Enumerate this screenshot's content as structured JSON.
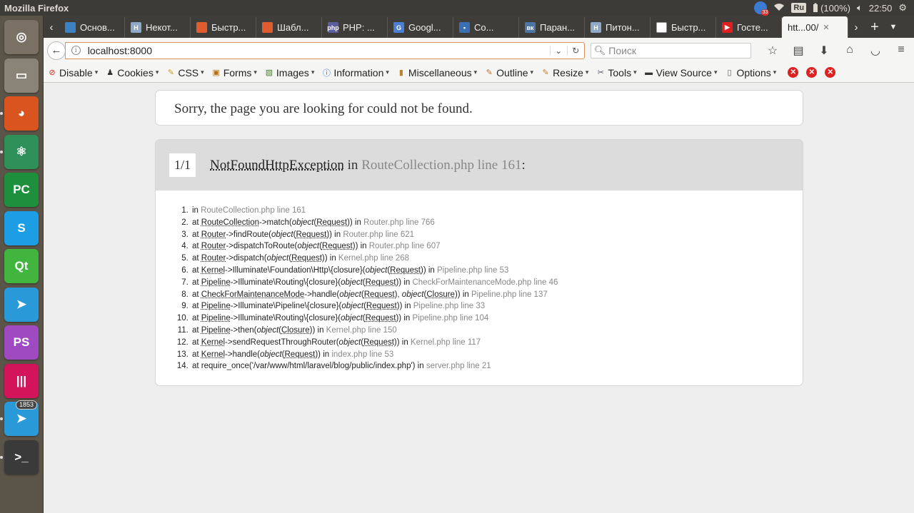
{
  "window": {
    "title": "Mozilla Firefox"
  },
  "tray": {
    "badge_count": "33",
    "keyboard": "Ru",
    "battery": "(100%)",
    "clock": "22:50"
  },
  "launcher": [
    {
      "name": "dash-home-icon",
      "color": "#7a7164"
    },
    {
      "name": "files-icon",
      "color": "#8a8378"
    },
    {
      "name": "firefox-icon",
      "color": "#d9541e"
    },
    {
      "name": "atom-icon",
      "color": "#2f9159"
    },
    {
      "name": "pycharm-icon",
      "color": "#1e8f3c"
    },
    {
      "name": "skype-icon",
      "color": "#1c9de4"
    },
    {
      "name": "qt-creator-icon",
      "color": "#41b53e"
    },
    {
      "name": "telegram-icon",
      "color": "#2a99d8"
    },
    {
      "name": "phpstorm-icon",
      "color": "#a04ac2"
    },
    {
      "name": "unknown-app-icon",
      "color": "#d4145a"
    },
    {
      "name": "telegram-2-icon",
      "color": "#2a99d8",
      "badge": "1853"
    },
    {
      "name": "terminal-icon",
      "color": "#3a3a3a"
    }
  ],
  "tabs": [
    {
      "label": "Основ...",
      "fav": "#3a82c4",
      "fav_text": ""
    },
    {
      "label": "Некот...",
      "fav": "#8fa9c8",
      "fav_text": "H"
    },
    {
      "label": "Быстр...",
      "fav": "#e05c2e",
      "fav_text": ""
    },
    {
      "label": "Шабл...",
      "fav": "#e05c2e",
      "fav_text": ""
    },
    {
      "label": "PHP: ...",
      "fav": "#5a5e9e",
      "fav_text": "php"
    },
    {
      "label": "Googl...",
      "fav": "#4a7fd6",
      "fav_text": "G"
    },
    {
      "label": "Co...",
      "fav": "#3a6fb3",
      "fav_text": "▪"
    },
    {
      "label": "Паран...",
      "fav": "#4c75a3",
      "fav_text": "вк"
    },
    {
      "label": "Питон...",
      "fav": "#8fa9c8",
      "fav_text": "H"
    },
    {
      "label": "Быстр...",
      "fav": "#ffffff",
      "fav_text": ""
    },
    {
      "label": "Госте...",
      "fav": "#e02020",
      "fav_text": "▶"
    },
    {
      "label": "htt...00/",
      "fav": "",
      "fav_text": "",
      "active": true
    }
  ],
  "nav": {
    "url": "localhost:8000",
    "search_placeholder": "Поиск"
  },
  "webdev": [
    {
      "label": "Disable",
      "icon": "disable-icon",
      "color": "#d22"
    },
    {
      "label": "Cookies",
      "icon": "cookies-icon",
      "color": "#333"
    },
    {
      "label": "CSS",
      "icon": "css-icon",
      "color": "#c9a020"
    },
    {
      "label": "Forms",
      "icon": "forms-icon",
      "color": "#b07020"
    },
    {
      "label": "Images",
      "icon": "images-icon",
      "color": "#4a8030"
    },
    {
      "label": "Information",
      "icon": "information-icon",
      "color": "#2a6ad0"
    },
    {
      "label": "Miscellaneous",
      "icon": "miscellaneous-icon",
      "color": "#c08030"
    },
    {
      "label": "Outline",
      "icon": "outline-icon",
      "color": "#c07020"
    },
    {
      "label": "Resize",
      "icon": "resize-icon",
      "color": "#c08030"
    },
    {
      "label": "Tools",
      "icon": "tools-icon",
      "color": "#556"
    },
    {
      "label": "View Source",
      "icon": "view-source-icon",
      "color": "#333"
    },
    {
      "label": "Options",
      "icon": "options-icon",
      "color": "#555"
    }
  ],
  "page": {
    "sorry": "Sorry, the page you are looking for could not be found.",
    "exception": {
      "count": "1/1",
      "class": "NotFoundHttpException",
      "in": " in ",
      "location": "RouteCollection.php line 161",
      "colon": ":"
    },
    "trace": [
      [
        {
          "t": "in "
        },
        {
          "t": "RouteCollection.php line 161",
          "c": "g"
        }
      ],
      [
        {
          "t": "at "
        },
        {
          "t": "RouteCollection",
          "c": "a"
        },
        {
          "t": "->match("
        },
        {
          "t": "object",
          "c": "i"
        },
        {
          "t": "("
        },
        {
          "t": "Request",
          "c": "a"
        },
        {
          "t": ")) in "
        },
        {
          "t": "Router.php line 766",
          "c": "g"
        }
      ],
      [
        {
          "t": "at "
        },
        {
          "t": "Router",
          "c": "a"
        },
        {
          "t": "->findRoute("
        },
        {
          "t": "object",
          "c": "i"
        },
        {
          "t": "("
        },
        {
          "t": "Request",
          "c": "a"
        },
        {
          "t": ")) in "
        },
        {
          "t": "Router.php line 621",
          "c": "g"
        }
      ],
      [
        {
          "t": "at "
        },
        {
          "t": "Router",
          "c": "a"
        },
        {
          "t": "->dispatchToRoute("
        },
        {
          "t": "object",
          "c": "i"
        },
        {
          "t": "("
        },
        {
          "t": "Request",
          "c": "a"
        },
        {
          "t": ")) in "
        },
        {
          "t": "Router.php line 607",
          "c": "g"
        }
      ],
      [
        {
          "t": "at "
        },
        {
          "t": "Router",
          "c": "a"
        },
        {
          "t": "->dispatch("
        },
        {
          "t": "object",
          "c": "i"
        },
        {
          "t": "("
        },
        {
          "t": "Request",
          "c": "a"
        },
        {
          "t": ")) in "
        },
        {
          "t": "Kernel.php line 268",
          "c": "g"
        }
      ],
      [
        {
          "t": "at "
        },
        {
          "t": "Kernel",
          "c": "a"
        },
        {
          "t": "->Illuminate\\Foundation\\Http\\{closure}("
        },
        {
          "t": "object",
          "c": "i"
        },
        {
          "t": "("
        },
        {
          "t": "Request",
          "c": "a"
        },
        {
          "t": ")) in "
        },
        {
          "t": "Pipeline.php line 53",
          "c": "g"
        }
      ],
      [
        {
          "t": "at "
        },
        {
          "t": "Pipeline",
          "c": "a"
        },
        {
          "t": "->Illuminate\\Routing\\{closure}("
        },
        {
          "t": "object",
          "c": "i"
        },
        {
          "t": "("
        },
        {
          "t": "Request",
          "c": "a"
        },
        {
          "t": ")) in "
        },
        {
          "t": "CheckForMaintenanceMode.php line 46",
          "c": "g"
        }
      ],
      [
        {
          "t": "at "
        },
        {
          "t": "CheckForMaintenanceMode",
          "c": "a"
        },
        {
          "t": "->handle("
        },
        {
          "t": "object",
          "c": "i"
        },
        {
          "t": "("
        },
        {
          "t": "Request",
          "c": "a"
        },
        {
          "t": "), "
        },
        {
          "t": "object",
          "c": "i"
        },
        {
          "t": "("
        },
        {
          "t": "Closure",
          "c": "a"
        },
        {
          "t": ")) in "
        },
        {
          "t": "Pipeline.php line 137",
          "c": "g"
        }
      ],
      [
        {
          "t": "at "
        },
        {
          "t": "Pipeline",
          "c": "a"
        },
        {
          "t": "->Illuminate\\Pipeline\\{closure}("
        },
        {
          "t": "object",
          "c": "i"
        },
        {
          "t": "("
        },
        {
          "t": "Request",
          "c": "a"
        },
        {
          "t": ")) in "
        },
        {
          "t": "Pipeline.php line 33",
          "c": "g"
        }
      ],
      [
        {
          "t": "at "
        },
        {
          "t": "Pipeline",
          "c": "a"
        },
        {
          "t": "->Illuminate\\Routing\\{closure}("
        },
        {
          "t": "object",
          "c": "i"
        },
        {
          "t": "("
        },
        {
          "t": "Request",
          "c": "a"
        },
        {
          "t": ")) in "
        },
        {
          "t": "Pipeline.php line 104",
          "c": "g"
        }
      ],
      [
        {
          "t": "at "
        },
        {
          "t": "Pipeline",
          "c": "a"
        },
        {
          "t": "->then("
        },
        {
          "t": "object",
          "c": "i"
        },
        {
          "t": "("
        },
        {
          "t": "Closure",
          "c": "a"
        },
        {
          "t": ")) in "
        },
        {
          "t": "Kernel.php line 150",
          "c": "g"
        }
      ],
      [
        {
          "t": "at "
        },
        {
          "t": "Kernel",
          "c": "a"
        },
        {
          "t": "->sendRequestThroughRouter("
        },
        {
          "t": "object",
          "c": "i"
        },
        {
          "t": "("
        },
        {
          "t": "Request",
          "c": "a"
        },
        {
          "t": ")) in "
        },
        {
          "t": "Kernel.php line 117",
          "c": "g"
        }
      ],
      [
        {
          "t": "at "
        },
        {
          "t": "Kernel",
          "c": "a"
        },
        {
          "t": "->handle("
        },
        {
          "t": "object",
          "c": "i"
        },
        {
          "t": "("
        },
        {
          "t": "Request",
          "c": "a"
        },
        {
          "t": ")) in "
        },
        {
          "t": "index.php line 53",
          "c": "g"
        }
      ],
      [
        {
          "t": "at require_once('/var/www/html/laravel/blog/public/index.php') in "
        },
        {
          "t": "server.php line 21",
          "c": "g"
        }
      ]
    ]
  }
}
